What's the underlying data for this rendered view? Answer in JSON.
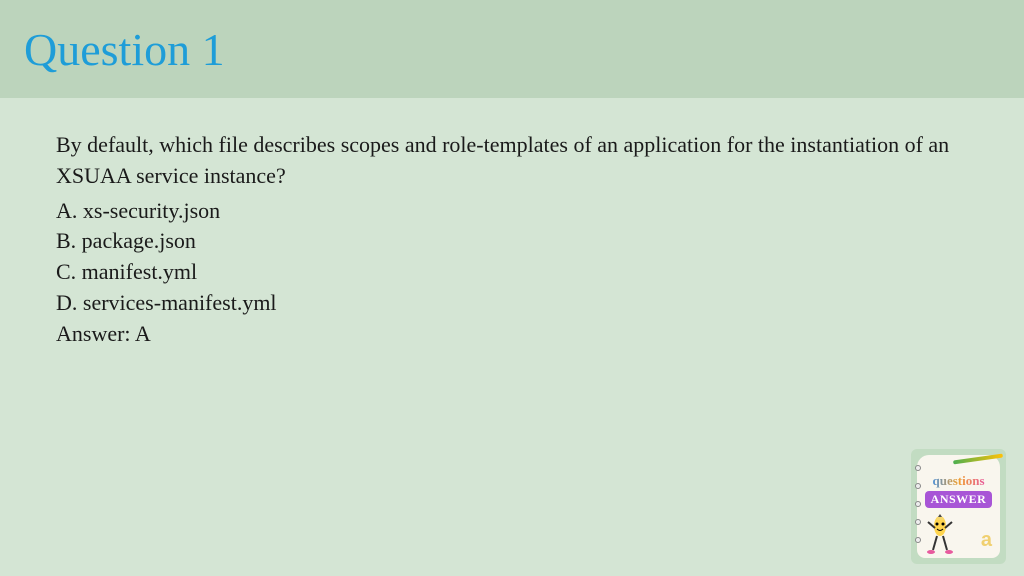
{
  "header": {
    "title": "Question 1"
  },
  "question": {
    "text": "By default, which file describes scopes and role-templates of an application for the instantiation of an XSUAA service instance?",
    "options": [
      "A. xs-security.json",
      "B. package.json",
      "C. manifest.yml",
      "D. services-manifest.yml"
    ],
    "answer": "Answer: A"
  },
  "badge": {
    "questions_label": "questions",
    "answer_label": "ANSWER",
    "letter": "a"
  }
}
